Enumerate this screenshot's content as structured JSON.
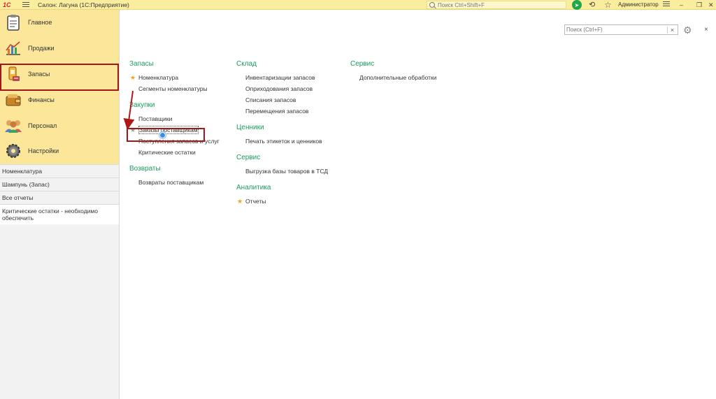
{
  "titlebar": {
    "logo": "1С",
    "app_title": "Салон: Лагуна  (1С:Предприятие)",
    "search_placeholder": "Поиск Ctrl+Shift+F",
    "user": "Администратор",
    "win_min": "–",
    "win_restore": "❐",
    "win_close": "✕"
  },
  "sidebar": {
    "nav": [
      {
        "label": "Главное",
        "icon": "clipboard-icon"
      },
      {
        "label": "Продажи",
        "icon": "sales-chart-icon"
      },
      {
        "label": "Запасы",
        "icon": "stock-icon"
      },
      {
        "label": "Финансы",
        "icon": "wallet-icon"
      },
      {
        "label": "Персонал",
        "icon": "people-icon"
      },
      {
        "label": "Настройки",
        "icon": "gear-icon"
      }
    ],
    "active_index": 2,
    "recent": [
      "Номенклатура",
      "Шампунь (Запас)",
      "Все отчеты",
      "Критические остатки - необходимо обеспечить"
    ]
  },
  "content": {
    "search_placeholder": "Поиск (Ctrl+F)",
    "search_clear": "×",
    "close": "×",
    "columns": [
      {
        "groups": [
          {
            "title": "Запасы",
            "items": [
              {
                "label": "Номенклатура",
                "fav": "star"
              },
              {
                "label": "Сегменты номенклатуры",
                "fav": ""
              }
            ]
          },
          {
            "title": "Закупки",
            "items": [
              {
                "label": "Поставщики",
                "fav": ""
              },
              {
                "label": "Заказы поставщикам",
                "fav": "grey"
              },
              {
                "label": "Поступления запасов и услуг",
                "fav": ""
              },
              {
                "label": "Критические остатки",
                "fav": ""
              }
            ]
          },
          {
            "title": "Возвраты",
            "items": [
              {
                "label": "Возвраты поставщикам",
                "fav": ""
              }
            ]
          }
        ]
      },
      {
        "groups": [
          {
            "title": "Склад",
            "items": [
              {
                "label": "Инвентаризации запасов",
                "fav": ""
              },
              {
                "label": "Оприходования запасов",
                "fav": ""
              },
              {
                "label": "Списания запасов",
                "fav": ""
              },
              {
                "label": "Перемещения запасов",
                "fav": ""
              }
            ]
          },
          {
            "title": "Ценники",
            "items": [
              {
                "label": "Печать этикеток и ценников",
                "fav": ""
              }
            ]
          },
          {
            "title": "Сервис",
            "items": [
              {
                "label": "Выгрузка базы товаров в ТСД",
                "fav": ""
              }
            ]
          },
          {
            "title": "Аналитика",
            "items": [
              {
                "label": "Отчеты",
                "fav": "star"
              }
            ]
          }
        ]
      },
      {
        "groups": [
          {
            "title": "Сервис",
            "items": [
              {
                "label": "Дополнительные обработки",
                "fav": ""
              }
            ]
          }
        ]
      }
    ]
  },
  "colors": {
    "section_nav_bg": "#fbe69a",
    "title_bar_bg": "#fbed9e",
    "group_title": "#1a9e5c",
    "highlight_frame": "#a01818",
    "favorite_star": "#f2a11a"
  }
}
